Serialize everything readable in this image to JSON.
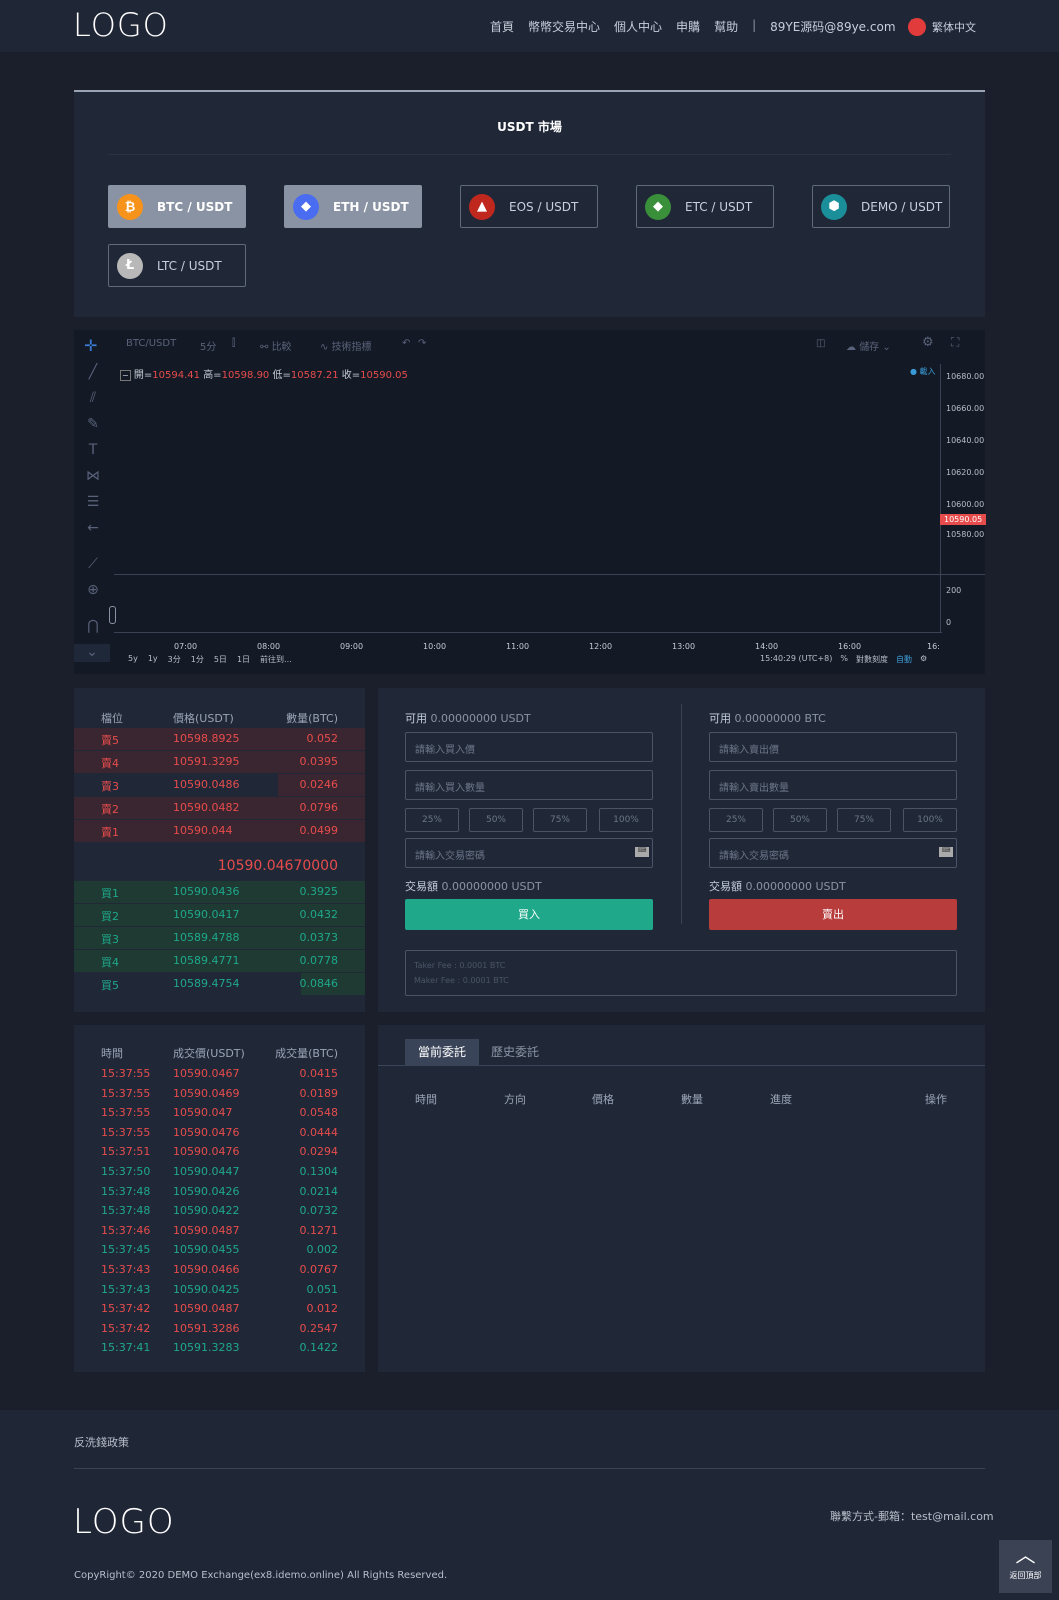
{
  "header": {
    "logo": "LOGO",
    "nav": [
      "首頁",
      "幣幣交易中心",
      "個人中心",
      "申購",
      "幫助"
    ],
    "sep": "|",
    "email": "89YE源码@89ye.com",
    "lang": "繁体中文"
  },
  "market": {
    "title": "USDT 市場",
    "pairs": [
      {
        "label": "BTC / USDT",
        "icon": "bitcoin-icon",
        "glyph": "₿",
        "color": "#f7931a",
        "active": true
      },
      {
        "label": "ETH / USDT",
        "icon": "ethereum-icon",
        "glyph": "◆",
        "color": "#4a6cf0",
        "active": true
      },
      {
        "label": "EOS / USDT",
        "icon": "eos-icon",
        "glyph": "▲",
        "color": "#c0281e",
        "active": false
      },
      {
        "label": "ETC / USDT",
        "icon": "ethereum-classic-icon",
        "glyph": "◆",
        "color": "#3a8f3a",
        "active": false
      },
      {
        "label": "DEMO / USDT",
        "icon": "demo-icon",
        "glyph": "⬢",
        "color": "#1a8f9a",
        "active": false
      },
      {
        "label": "LTC / USDT",
        "icon": "litecoin-icon",
        "glyph": "Ł",
        "color": "#b8b8b8",
        "active": false
      }
    ]
  },
  "chart_toolbar": {
    "symbol": "BTC/USDT",
    "interval": "5分",
    "compare": "比較",
    "indicators": "技術指標",
    "save": "儲存",
    "loaded": "● 載入"
  },
  "ohlc": {
    "open_label": "開=",
    "open": "10594.41",
    "high_label": "高=",
    "high": "10598.90",
    "low_label": "低=",
    "low": "10587.21",
    "close_label": "收=",
    "close": "10590.05"
  },
  "chart_data": {
    "type": "line",
    "symbol": "BTC/USDT",
    "y_ticks": [
      "10680.00",
      "10660.00",
      "10640.00",
      "10620.00",
      "10600.00",
      "10580.00"
    ],
    "last_price": "10590.05",
    "volume_ticks": [
      "200",
      "0"
    ],
    "x_ticks": [
      "07:00",
      "08:00",
      "09:00",
      "10:00",
      "11:00",
      "12:00",
      "13:00",
      "14:00",
      "16:00",
      "16:"
    ]
  },
  "chart_bottom": {
    "ranges": [
      "5y",
      "1y",
      "3分",
      "1分",
      "5日",
      "1日",
      "前往到..."
    ],
    "time": "15:40:29 (UTC+8)",
    "pct": "%",
    "log": "對數刻度",
    "auto": "自動"
  },
  "orderbook": {
    "headers": [
      "檔位",
      "價格(USDT)",
      "數量(BTC)"
    ],
    "asks": [
      [
        "賣5",
        "10598.8925",
        "0.052"
      ],
      [
        "賣4",
        "10591.3295",
        "0.0395"
      ],
      [
        "賣3",
        "10590.0486",
        "0.0246"
      ],
      [
        "賣2",
        "10590.0482",
        "0.0796"
      ],
      [
        "賣1",
        "10590.044",
        "0.0499"
      ]
    ],
    "last": "10590.04670000",
    "bids": [
      [
        "買1",
        "10590.0436",
        "0.3925"
      ],
      [
        "買2",
        "10590.0417",
        "0.0432"
      ],
      [
        "買3",
        "10589.4788",
        "0.0373"
      ],
      [
        "買4",
        "10589.4771",
        "0.0778"
      ],
      [
        "買5",
        "10589.4754",
        "0.0846"
      ]
    ]
  },
  "trade": {
    "buy": {
      "avail_label": "可用",
      "avail": "0.00000000 USDT",
      "price_ph": "請輸入買入價",
      "amount_ph": "請輸入買入數量",
      "pwd_ph": "請輸入交易密碼",
      "total_label": "交易額",
      "total": "0.00000000 USDT",
      "button": "買入"
    },
    "sell": {
      "avail_label": "可用",
      "avail": "0.00000000 BTC",
      "price_ph": "請輸入賣出價",
      "amount_ph": "請輸入賣出數量",
      "pwd_ph": "請輸入交易密碼",
      "total_label": "交易額",
      "total": "0.00000000 USDT",
      "button": "賣出"
    },
    "pcts": [
      "25%",
      "50%",
      "75%",
      "100%"
    ],
    "taker": "Taker Fee : 0.0001 BTC",
    "maker": "Maker Fee : 0.0001 BTC"
  },
  "trades": {
    "headers": [
      "時間",
      "成交價(USDT)",
      "成交量(BTC)"
    ],
    "rows": [
      [
        "15:37:55",
        "10590.0467",
        "0.0415",
        "red"
      ],
      [
        "15:37:55",
        "10590.0469",
        "0.0189",
        "red"
      ],
      [
        "15:37:55",
        "10590.047",
        "0.0548",
        "red"
      ],
      [
        "15:37:55",
        "10590.0476",
        "0.0444",
        "red"
      ],
      [
        "15:37:51",
        "10590.0476",
        "0.0294",
        "red"
      ],
      [
        "15:37:50",
        "10590.0447",
        "0.1304",
        "green"
      ],
      [
        "15:37:48",
        "10590.0426",
        "0.0214",
        "green"
      ],
      [
        "15:37:48",
        "10590.0422",
        "0.0732",
        "green"
      ],
      [
        "15:37:46",
        "10590.0487",
        "0.1271",
        "red"
      ],
      [
        "15:37:45",
        "10590.0455",
        "0.002",
        "green"
      ],
      [
        "15:37:43",
        "10590.0466",
        "0.0767",
        "red"
      ],
      [
        "15:37:43",
        "10590.0425",
        "0.051",
        "green"
      ],
      [
        "15:37:42",
        "10590.0487",
        "0.012",
        "red"
      ],
      [
        "15:37:42",
        "10591.3286",
        "0.2547",
        "red"
      ],
      [
        "15:37:41",
        "10591.3283",
        "0.1422",
        "green"
      ]
    ]
  },
  "orders": {
    "tabs": [
      "當前委託",
      "歷史委託"
    ],
    "headers": [
      "時間",
      "方向",
      "價格",
      "數量",
      "進度",
      "操作"
    ]
  },
  "footer": {
    "policy": "反洗錢政策",
    "logo": "LOGO",
    "contact": "聯繫方式-郵箱：test@mail.com",
    "copyright": "CopyRight© 2020 DEMO Exchange(ex8.idemo.online) All Rights Reserved.",
    "back_top": "返回頂部"
  }
}
